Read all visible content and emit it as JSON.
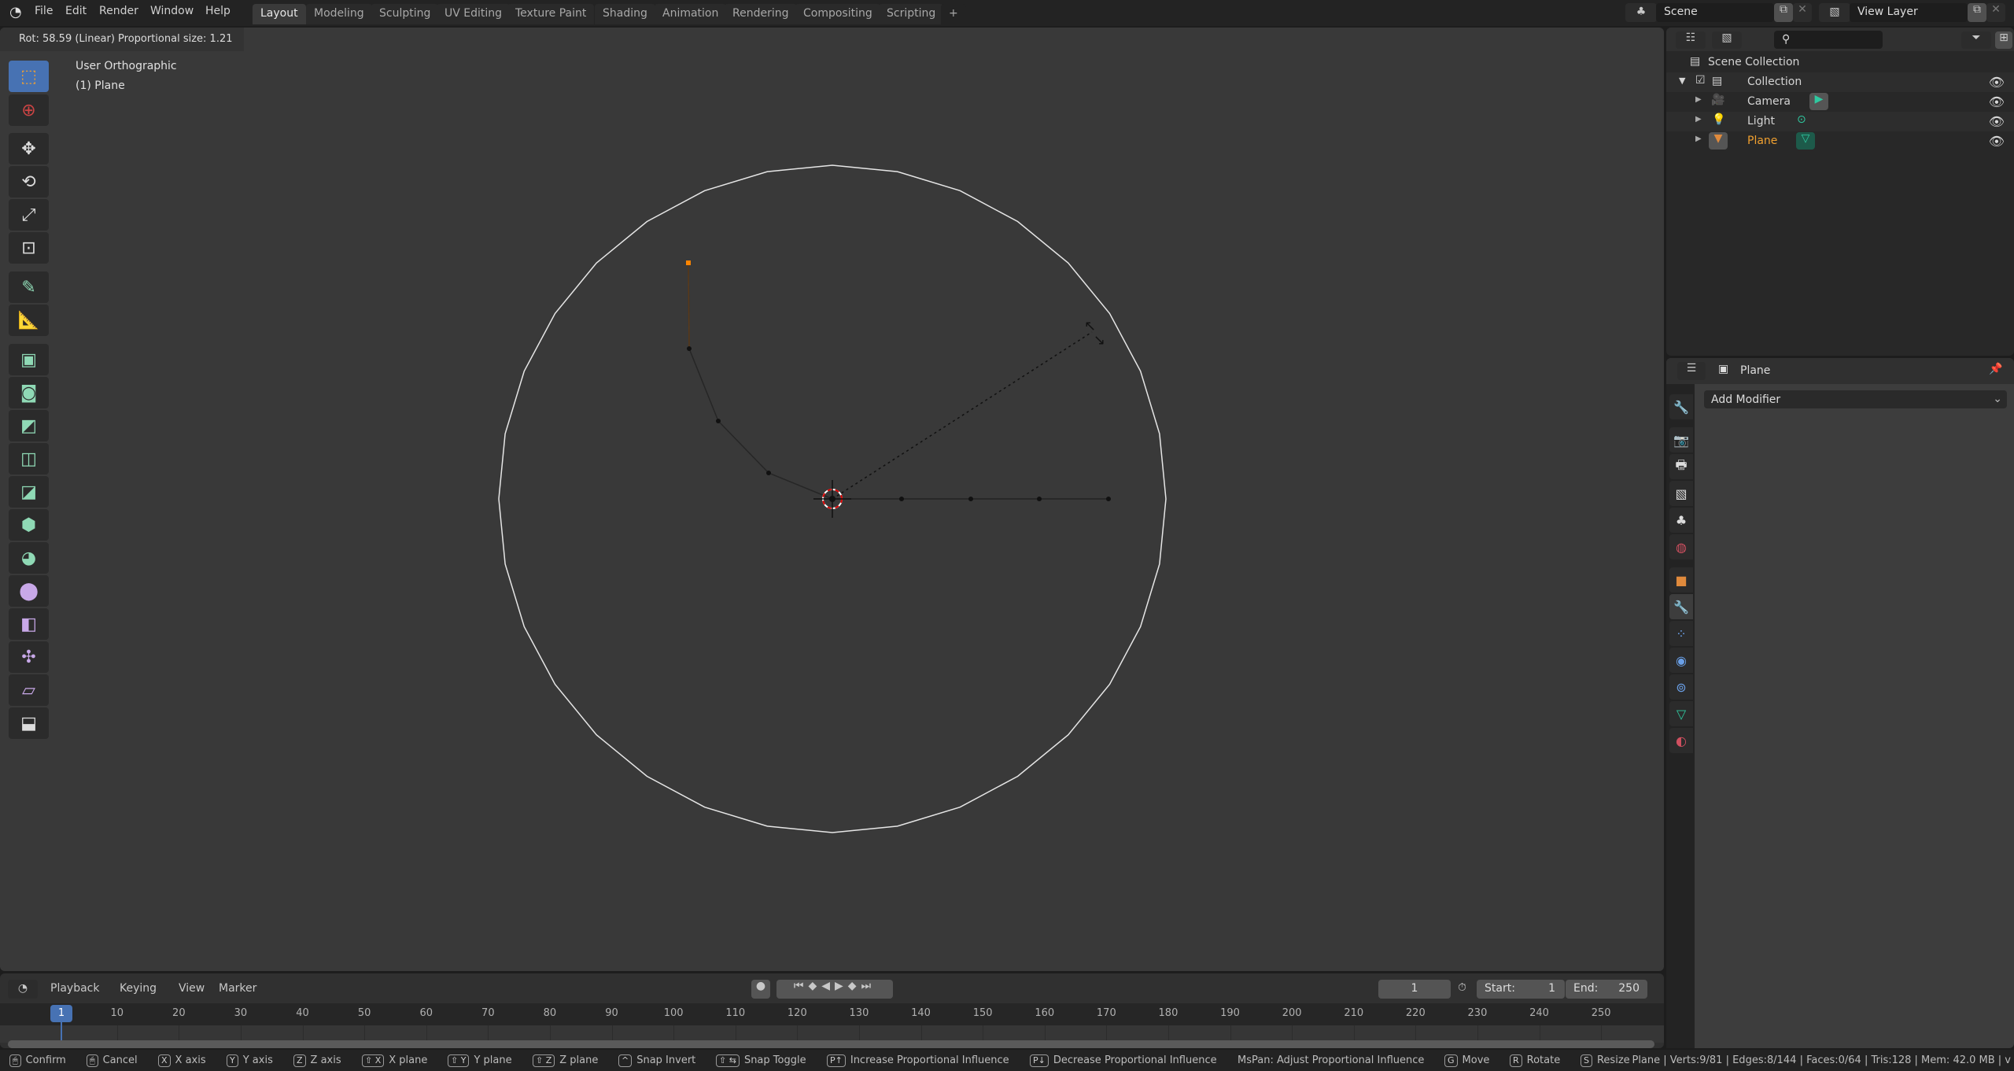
{
  "menubar": {
    "items": [
      "File",
      "Edit",
      "Render",
      "Window",
      "Help"
    ]
  },
  "workspaces": {
    "tabs": [
      "Layout",
      "Modeling",
      "Sculpting",
      "UV Editing",
      "Texture Paint",
      "Shading",
      "Animation",
      "Rendering",
      "Compositing",
      "Scripting"
    ],
    "active": "Layout",
    "add": "+"
  },
  "scene": {
    "name": "Scene",
    "view_layer": "View Layer"
  },
  "viewport": {
    "operator_status": "Rot: 58.59 (Linear) Proportional size: 1.21",
    "view_name": "User Orthographic",
    "object_name": "(1) Plane",
    "tools": [
      "select-box",
      "cursor",
      "move",
      "rotate",
      "scale",
      "transform",
      "annotate",
      "measure",
      "extrude-region",
      "inset-faces",
      "bevel",
      "loop-cut",
      "knife",
      "poly-build",
      "spin",
      "smooth",
      "edge-slide",
      "shrink-fatten",
      "shear",
      "rip-region"
    ],
    "colors": {
      "background": "#393939",
      "circle": "#e6e6e6",
      "selected_vertex": "#ff8500",
      "edge": "#1a1a1a"
    }
  },
  "outliner": {
    "root": "Scene Collection",
    "items": [
      {
        "label": "Collection",
        "icon": "collection-icon"
      },
      {
        "label": "Camera",
        "icon": "camera-icon"
      },
      {
        "label": "Light",
        "icon": "light-icon"
      },
      {
        "label": "Plane",
        "icon": "mesh-icon",
        "active": true
      }
    ]
  },
  "properties": {
    "object_name": "Plane",
    "add_modifier": "Add Modifier",
    "tabs": [
      "tool",
      "render",
      "output",
      "view-layer",
      "scene",
      "world",
      "object",
      "modifiers",
      "particles",
      "physics",
      "constraints",
      "data",
      "material"
    ],
    "active_tab": "modifiers"
  },
  "timeline": {
    "menus": [
      "Playback",
      "Keying",
      "View",
      "Marker"
    ],
    "current_frame": "1",
    "start_label": "Start:",
    "start": "1",
    "end_label": "End:",
    "end": "250",
    "ticks": [
      "10",
      "20",
      "30",
      "40",
      "50",
      "60",
      "70",
      "80",
      "90",
      "100",
      "110",
      "120",
      "130",
      "140",
      "150",
      "160",
      "170",
      "180",
      "190",
      "200",
      "210",
      "220",
      "230",
      "240",
      "250"
    ],
    "playhead": "1"
  },
  "statusbar": {
    "items": [
      {
        "key": "🖱",
        "label": "Confirm"
      },
      {
        "key": "🖱",
        "label": "Cancel"
      },
      {
        "key": "X",
        "label": "X axis"
      },
      {
        "key": "Y",
        "label": "Y axis"
      },
      {
        "key": "Z",
        "label": "Z axis"
      },
      {
        "key": "⇧ X",
        "label": "X plane"
      },
      {
        "key": "⇧ Y",
        "label": "Y plane"
      },
      {
        "key": "⇧ Z",
        "label": "Z plane"
      },
      {
        "key": "^",
        "label": "Snap Invert"
      },
      {
        "key": "⇧ ⇆",
        "label": "Snap Toggle"
      },
      {
        "key": "P↑",
        "label": "Increase Proportional Influence"
      },
      {
        "key": "P↓",
        "label": "Decrease Proportional Influence"
      },
      {
        "key": "",
        "label": "MsPan: Adjust Proportional Influence"
      },
      {
        "key": "G",
        "label": "Move"
      },
      {
        "key": "R",
        "label": "Rotate"
      },
      {
        "key": "S",
        "label": "Resize"
      }
    ],
    "stats": "Plane | Verts:9/81 | Edges:8/144 | Faces:0/64 | Tris:128 | Mem: 42.0 MB | v"
  }
}
